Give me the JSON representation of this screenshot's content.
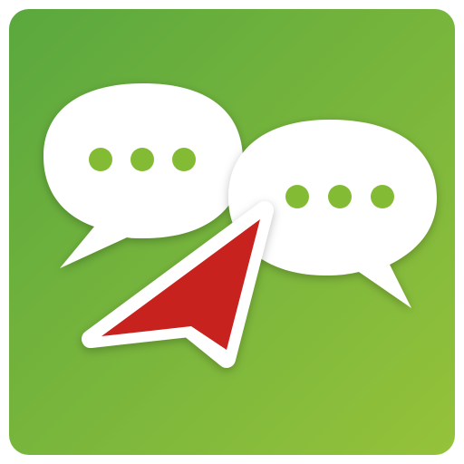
{
  "icon": {
    "type": "app-icon",
    "symbols": [
      "speech-bubble-icon",
      "speech-bubble-icon",
      "cursor-arrow-icon"
    ],
    "colors": {
      "background_top_left": "#5aa83e",
      "background_bottom_right": "#95c23a",
      "bubble_fill": "#ffffff",
      "typing_dots": "#84bb34",
      "arrow_fill": "#c8221e",
      "arrow_outline": "#ffffff"
    }
  }
}
